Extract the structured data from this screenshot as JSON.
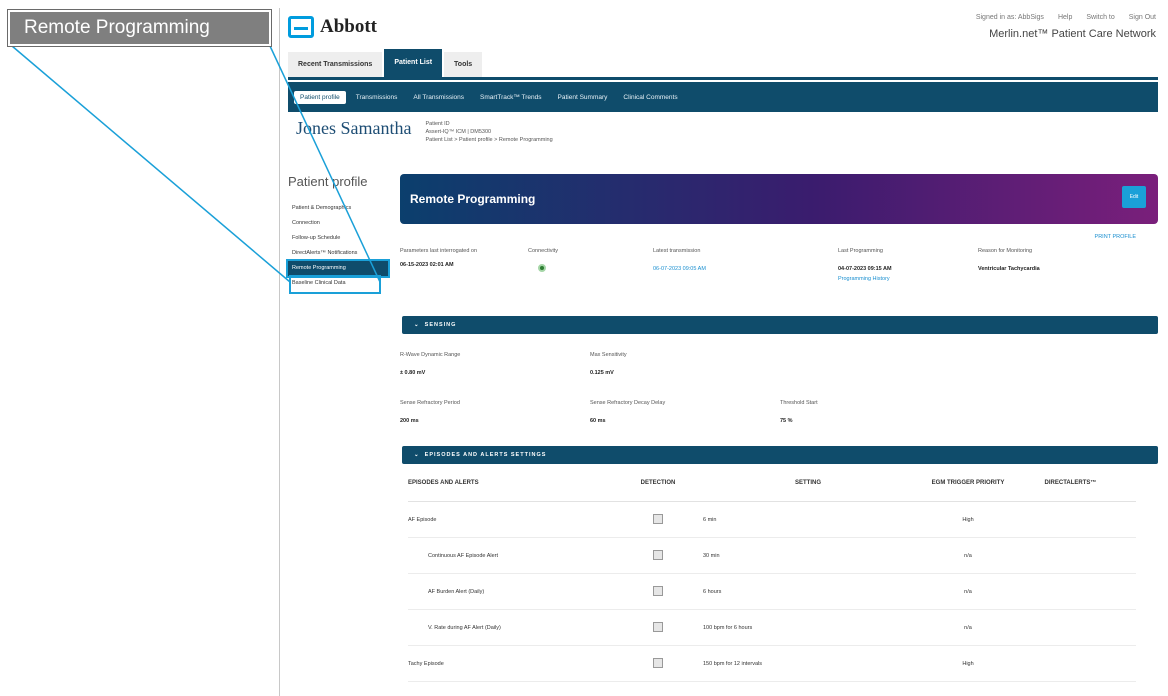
{
  "callout": {
    "label": "Remote Programming"
  },
  "header": {
    "logo_text": "Abbott",
    "links": [
      "Signed in as: AbbSigs",
      "Help",
      "Switch to",
      "Sign Out"
    ],
    "network": "Merlin.net™ Patient Care Network"
  },
  "tabs_primary": [
    "Recent Transmissions",
    "Patient List",
    "Tools"
  ],
  "tabs_secondary": [
    "Patient profile",
    "Transmissions",
    "All Transmissions",
    "SmartTrack™ Trends",
    "Patient Summary",
    "Clinical Comments"
  ],
  "patient": {
    "name": "Jones Samantha",
    "meta1": "Patient ID",
    "meta2": "Assert-IQ™ ICM | DM5300",
    "breadcrumb": "Patient List > Patient profile > Remote Programming"
  },
  "sidebar": {
    "title": "Patient profile",
    "items": [
      "Patient & Demographics",
      "Connection",
      "Follow-up Schedule",
      "DirectAlerts™ Notifications",
      "Remote Programming",
      "Baseline Clinical Data"
    ]
  },
  "banner": {
    "title": "Remote Programming",
    "button": "Edit"
  },
  "print_label": "PRINT PROFILE",
  "summary": {
    "parameters_label": "Parameters last interrogated on",
    "parameters_value": "06-15-2023 02:01 AM",
    "connectivity_label": "Connectivity",
    "latest_label": "Latest transmission",
    "latest_value": "06-07-2023 09:05 AM",
    "last_prog_label": "Last Programming",
    "last_prog_value": "04-07-2023 09:15 AM",
    "last_prog_link": "Programming History",
    "reason_label": "Reason for Monitoring",
    "reason_value": "Ventricular Tachycardia"
  },
  "sensing": {
    "header": "SENSING",
    "fields": [
      {
        "label": "R-Wave Dynamic Range",
        "value": "± 0.80 mV"
      },
      {
        "label": "Max Sensitivity",
        "value": "0.125 mV"
      },
      {
        "label": "Sense Refractory Period",
        "value": "200 ms"
      },
      {
        "label": "Sense Refractory Decay Delay",
        "value": "60 ms"
      },
      {
        "label": "Threshold Start",
        "value": "75 %"
      }
    ]
  },
  "episodes": {
    "header": "EPISODES AND ALERTS SETTINGS",
    "columns": [
      "EPISODES AND ALERTS",
      "DETECTION",
      "SETTING",
      "EGM TRIGGER PRIORITY",
      "DIRECTALERTS™"
    ],
    "rows": [
      {
        "name": "AF Episode",
        "setting": "6 min",
        "priority": "High",
        "indent": false
      },
      {
        "name": "Continuous AF Episode Alert",
        "setting": "30 min",
        "priority": "n/a",
        "indent": true
      },
      {
        "name": "AF Burden Alert (Daily)",
        "setting": "6 hours",
        "priority": "n/a",
        "indent": true
      },
      {
        "name": "V. Rate during AF Alert (Daily)",
        "setting": "100 bpm for 6 hours",
        "priority": "n/a",
        "indent": true
      },
      {
        "name": "Tachy Episode",
        "setting": "150 bpm for 12 intervals",
        "priority": "High",
        "indent": false
      }
    ]
  }
}
